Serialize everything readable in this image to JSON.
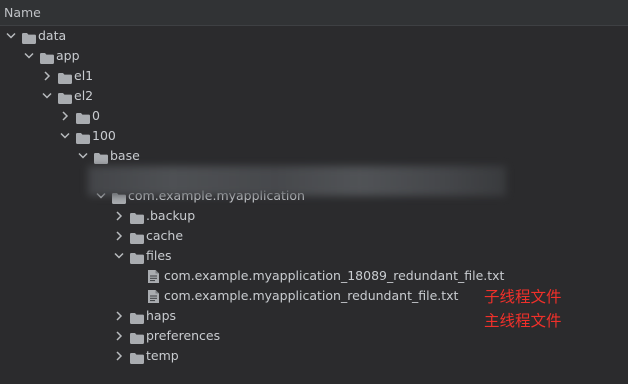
{
  "header": {
    "column_name": "Name"
  },
  "tree": [
    {
      "label": "data",
      "indent": 0,
      "expanded": true,
      "type": "folder"
    },
    {
      "label": "app",
      "indent": 1,
      "expanded": true,
      "type": "folder"
    },
    {
      "label": "el1",
      "indent": 2,
      "expanded": false,
      "type": "folder"
    },
    {
      "label": "el2",
      "indent": 2,
      "expanded": true,
      "type": "folder"
    },
    {
      "label": "0",
      "indent": 3,
      "expanded": false,
      "type": "folder"
    },
    {
      "label": "100",
      "indent": 3,
      "expanded": true,
      "type": "folder"
    },
    {
      "label": "base",
      "indent": 4,
      "expanded": true,
      "type": "folder"
    },
    {
      "label": "",
      "indent": 5,
      "expanded": null,
      "type": "redacted"
    },
    {
      "label": "com.example.myapplication",
      "indent": 5,
      "expanded": true,
      "type": "folder"
    },
    {
      "label": ".backup",
      "indent": 6,
      "expanded": false,
      "type": "folder"
    },
    {
      "label": "cache",
      "indent": 6,
      "expanded": false,
      "type": "folder"
    },
    {
      "label": "files",
      "indent": 6,
      "expanded": true,
      "type": "folder"
    },
    {
      "label": "com.example.myapplication_18089_redundant_file.txt",
      "indent": 7,
      "expanded": null,
      "type": "file"
    },
    {
      "label": "com.example.myapplication_redundant_file.txt",
      "indent": 7,
      "expanded": null,
      "type": "file"
    },
    {
      "label": "haps",
      "indent": 6,
      "expanded": false,
      "type": "folder"
    },
    {
      "label": "preferences",
      "indent": 6,
      "expanded": false,
      "type": "folder"
    },
    {
      "label": "temp",
      "indent": 6,
      "expanded": false,
      "type": "folder"
    }
  ],
  "annotations": {
    "child_thread_file": "子线程文件",
    "main_thread_file": "主线程文件"
  },
  "colors": {
    "background": "#2b2b2d",
    "annotation": "#f0302a",
    "folder_icon": "#a9acb0"
  }
}
